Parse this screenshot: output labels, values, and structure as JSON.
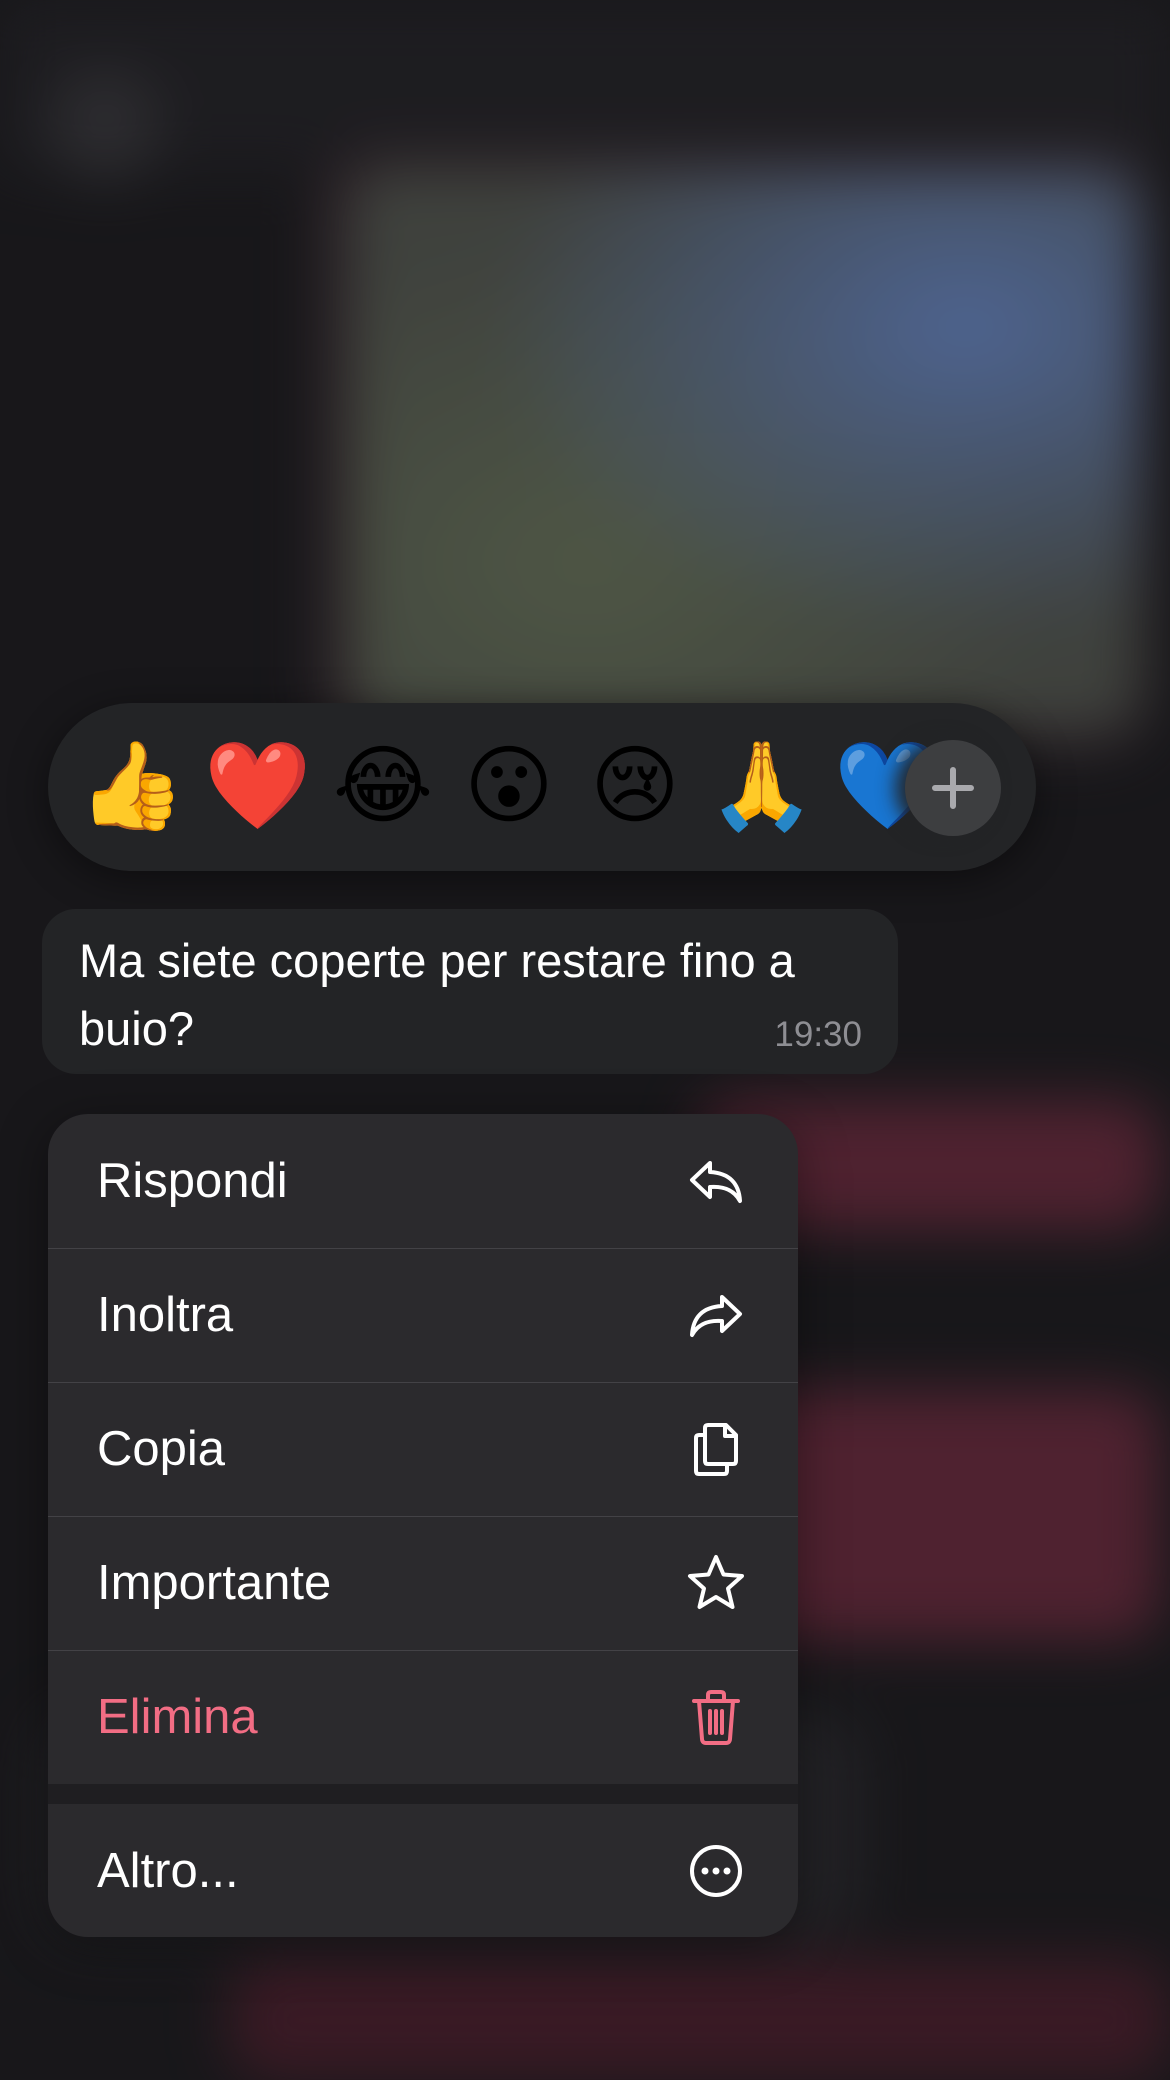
{
  "reactions": {
    "emojis": [
      {
        "name": "thumbs-up",
        "glyph": "👍"
      },
      {
        "name": "red-heart",
        "glyph": "❤️"
      },
      {
        "name": "tears-of-joy",
        "glyph": "😂"
      },
      {
        "name": "surprised-face",
        "glyph": "😮"
      },
      {
        "name": "crying-face",
        "glyph": "😢"
      },
      {
        "name": "folded-hands",
        "glyph": "🙏"
      },
      {
        "name": "blue-heart",
        "glyph": "💙"
      }
    ],
    "more_icon": "plus-icon"
  },
  "message": {
    "text": "Ma siete coperte per restare fino a buio?",
    "time": "19:30"
  },
  "menu": {
    "items": [
      {
        "label": "Rispondi",
        "icon": "reply-icon"
      },
      {
        "label": "Inoltra",
        "icon": "forward-icon"
      },
      {
        "label": "Copia",
        "icon": "copy-icon"
      },
      {
        "label": "Importante",
        "icon": "star-icon"
      },
      {
        "label": "Elimina",
        "icon": "trash-icon",
        "destructive": true
      }
    ],
    "more": {
      "label": "Altro...",
      "icon": "more-icon"
    }
  },
  "colors": {
    "surface": "#2b2a2d",
    "bubble": "#232426",
    "destructive": "#f26d84",
    "text": "#ffffff",
    "timestamp": "#8e8e93"
  }
}
